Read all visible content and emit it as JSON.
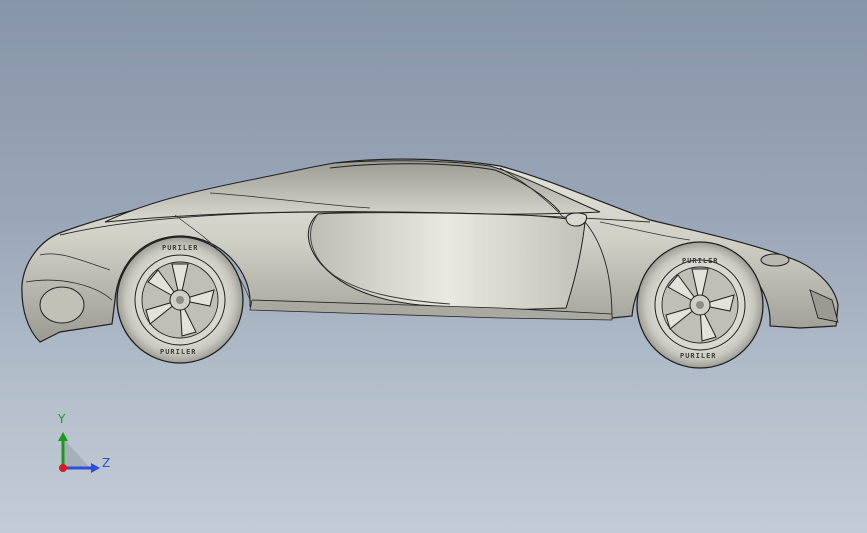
{
  "viewport": {
    "background_top": "#8795a8",
    "background_bottom": "#c3ccd6"
  },
  "model": {
    "body_color": "#c9c9c1",
    "edge_color": "#1f1f1f",
    "tire_brand": "PURILER"
  },
  "triad": {
    "y_label": "Y",
    "z_label": "Z",
    "y_color": "#1a9a1a",
    "z_color": "#2a4fd8",
    "origin_color": "#d81a1a"
  }
}
